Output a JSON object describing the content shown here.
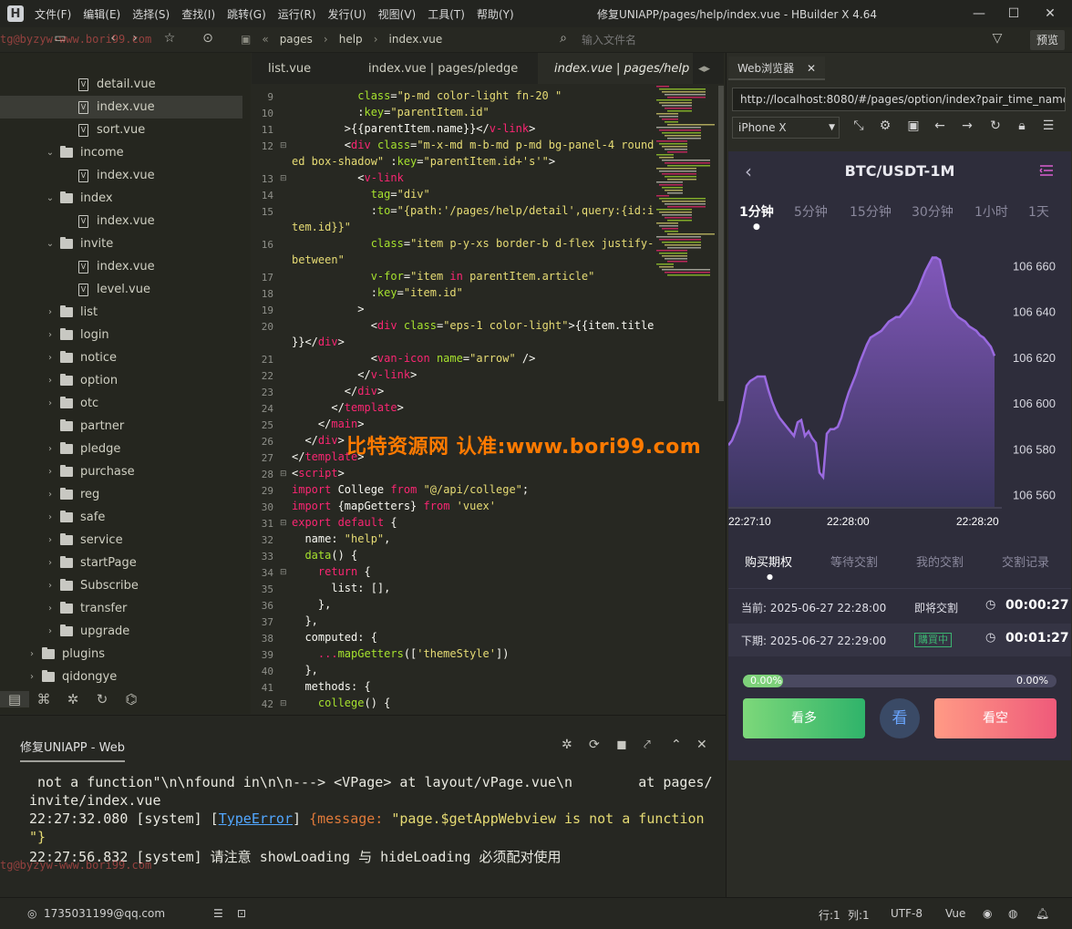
{
  "titlebar": {
    "logo": "H",
    "menus": [
      "文件(F)",
      "编辑(E)",
      "选择(S)",
      "查找(I)",
      "跳转(G)",
      "运行(R)",
      "发行(U)",
      "视图(V)",
      "工具(T)",
      "帮助(Y)"
    ],
    "title": "修复UNIAPP/pages/help/index.vue - HBuilder X 4.64"
  },
  "toolbar": {
    "crumbs": [
      "pages",
      "help",
      "index.vue"
    ],
    "file_search_placeholder": "输入文件名",
    "preview": "预览"
  },
  "sidebar": {
    "items": [
      {
        "label": "detail.vue",
        "type": "file",
        "depth": 2,
        "arrow": ""
      },
      {
        "label": "index.vue",
        "type": "file",
        "depth": 2,
        "arrow": "",
        "selected": true
      },
      {
        "label": "sort.vue",
        "type": "file",
        "depth": 2,
        "arrow": ""
      },
      {
        "label": "income",
        "type": "folder",
        "depth": 1,
        "arrow": "v"
      },
      {
        "label": "index.vue",
        "type": "file",
        "depth": 2,
        "arrow": ""
      },
      {
        "label": "index",
        "type": "folder",
        "depth": 1,
        "arrow": "v"
      },
      {
        "label": "index.vue",
        "type": "file",
        "depth": 2,
        "arrow": ""
      },
      {
        "label": "invite",
        "type": "folder",
        "depth": 1,
        "arrow": "v"
      },
      {
        "label": "index.vue",
        "type": "file",
        "depth": 2,
        "arrow": ""
      },
      {
        "label": "level.vue",
        "type": "file",
        "depth": 2,
        "arrow": ""
      },
      {
        "label": "list",
        "type": "folder",
        "depth": 1,
        "arrow": ">"
      },
      {
        "label": "login",
        "type": "folder",
        "depth": 1,
        "arrow": ">"
      },
      {
        "label": "notice",
        "type": "folder",
        "depth": 1,
        "arrow": ">"
      },
      {
        "label": "option",
        "type": "folder",
        "depth": 1,
        "arrow": ">"
      },
      {
        "label": "otc",
        "type": "folder",
        "depth": 1,
        "arrow": ">"
      },
      {
        "label": "partner",
        "type": "folder",
        "depth": 1,
        "arrow": ""
      },
      {
        "label": "pledge",
        "type": "folder",
        "depth": 1,
        "arrow": ">"
      },
      {
        "label": "purchase",
        "type": "folder",
        "depth": 1,
        "arrow": ">"
      },
      {
        "label": "reg",
        "type": "folder",
        "depth": 1,
        "arrow": ">"
      },
      {
        "label": "safe",
        "type": "folder",
        "depth": 1,
        "arrow": ">"
      },
      {
        "label": "service",
        "type": "folder",
        "depth": 1,
        "arrow": ">"
      },
      {
        "label": "startPage",
        "type": "folder",
        "depth": 1,
        "arrow": ">"
      },
      {
        "label": "Subscribe",
        "type": "folder",
        "depth": 1,
        "arrow": ">"
      },
      {
        "label": "transfer",
        "type": "folder",
        "depth": 1,
        "arrow": ">"
      },
      {
        "label": "upgrade",
        "type": "folder",
        "depth": 1,
        "arrow": ">"
      },
      {
        "label": "plugins",
        "type": "folder",
        "depth": 0,
        "arrow": ">"
      },
      {
        "label": "qidongye",
        "type": "folder",
        "depth": 0,
        "arrow": ">"
      }
    ]
  },
  "editor": {
    "tabs": [
      "list.vue",
      "index.vue | pages/pledge",
      "index.vue | pages/help"
    ],
    "lines": [
      {
        "n": "9",
        "fold": false,
        "parts": [
          [
            "          ",
            "p"
          ],
          [
            "class",
            "a"
          ],
          [
            "=",
            "p"
          ],
          [
            "\"p-md color-light fn-20 \"",
            "s"
          ]
        ]
      },
      {
        "n": "10",
        "fold": false,
        "parts": [
          [
            "          :",
            "p"
          ],
          [
            "key",
            "a"
          ],
          [
            "=",
            "p"
          ],
          [
            "\"parentItem.id\"",
            "s"
          ]
        ]
      },
      {
        "n": "11",
        "fold": false,
        "parts": [
          [
            "        >{{parentItem.name}}</",
            "p"
          ],
          [
            "v-link",
            "t"
          ],
          [
            ">",
            "p"
          ]
        ]
      },
      {
        "n": "12",
        "fold": true,
        "parts": [
          [
            "        <",
            "p"
          ],
          [
            "div",
            "t"
          ],
          [
            " ",
            "p"
          ],
          [
            "class",
            "a"
          ],
          [
            "=",
            "p"
          ],
          [
            "\"m-x-md m-b-md p-md bg-panel-4 round",
            "s"
          ]
        ]
      },
      {
        "n": "",
        "fold": false,
        "parts": [
          [
            "ed box-shadow\"",
            "s"
          ],
          [
            " :",
            "p"
          ],
          [
            "key",
            "a"
          ],
          [
            "=",
            "p"
          ],
          [
            "\"parentItem.id+'s'\"",
            "s"
          ],
          [
            ">",
            "p"
          ]
        ]
      },
      {
        "n": "13",
        "fold": true,
        "parts": [
          [
            "          <",
            "p"
          ],
          [
            "v-link",
            "t"
          ]
        ]
      },
      {
        "n": "14",
        "fold": false,
        "parts": [
          [
            "            ",
            "p"
          ],
          [
            "tag",
            "a"
          ],
          [
            "=",
            "p"
          ],
          [
            "\"div\"",
            "s"
          ]
        ]
      },
      {
        "n": "15",
        "fold": false,
        "parts": [
          [
            "            :",
            "p"
          ],
          [
            "to",
            "a"
          ],
          [
            "=",
            "p"
          ],
          [
            "\"{path:'/pages/help/detail',query:{id:i",
            "s"
          ]
        ]
      },
      {
        "n": "",
        "fold": false,
        "parts": [
          [
            "tem.id}}\"",
            "s"
          ]
        ]
      },
      {
        "n": "16",
        "fold": false,
        "parts": [
          [
            "            ",
            "p"
          ],
          [
            "class",
            "a"
          ],
          [
            "=",
            "p"
          ],
          [
            "\"item p-y-xs border-b d-flex justify-",
            "s"
          ]
        ]
      },
      {
        "n": "",
        "fold": false,
        "parts": [
          [
            "between\"",
            "s"
          ]
        ]
      },
      {
        "n": "17",
        "fold": false,
        "parts": [
          [
            "            ",
            "p"
          ],
          [
            "v-for",
            "a"
          ],
          [
            "=",
            "p"
          ],
          [
            "\"item ",
            "s"
          ],
          [
            "in",
            "t"
          ],
          [
            " parentItem.article\"",
            "s"
          ]
        ]
      },
      {
        "n": "18",
        "fold": false,
        "parts": [
          [
            "            :",
            "p"
          ],
          [
            "key",
            "a"
          ],
          [
            "=",
            "p"
          ],
          [
            "\"item.id\"",
            "s"
          ]
        ]
      },
      {
        "n": "19",
        "fold": false,
        "parts": [
          [
            "          >",
            "p"
          ]
        ]
      },
      {
        "n": "20",
        "fold": false,
        "parts": [
          [
            "            <",
            "p"
          ],
          [
            "div",
            "t"
          ],
          [
            " ",
            "p"
          ],
          [
            "class",
            "a"
          ],
          [
            "=",
            "p"
          ],
          [
            "\"eps-1 color-light\"",
            "s"
          ],
          [
            ">{{item.title",
            "p"
          ]
        ]
      },
      {
        "n": "",
        "fold": false,
        "parts": [
          [
            "}}</",
            "p"
          ],
          [
            "div",
            "t"
          ],
          [
            ">",
            "p"
          ]
        ]
      },
      {
        "n": "21",
        "fold": false,
        "parts": [
          [
            "            <",
            "p"
          ],
          [
            "van-icon",
            "t"
          ],
          [
            " ",
            "p"
          ],
          [
            "name",
            "a"
          ],
          [
            "=",
            "p"
          ],
          [
            "\"arrow\"",
            "s"
          ],
          [
            " />",
            "p"
          ]
        ]
      },
      {
        "n": "22",
        "fold": false,
        "parts": [
          [
            "          </",
            "p"
          ],
          [
            "v-link",
            "t"
          ],
          [
            ">",
            "p"
          ]
        ]
      },
      {
        "n": "23",
        "fold": false,
        "parts": [
          [
            "        </",
            "p"
          ],
          [
            "div",
            "t"
          ],
          [
            ">",
            "p"
          ]
        ]
      },
      {
        "n": "24",
        "fold": false,
        "parts": [
          [
            "      </",
            "p"
          ],
          [
            "template",
            "t"
          ],
          [
            ">",
            "p"
          ]
        ]
      },
      {
        "n": "25",
        "fold": false,
        "parts": [
          [
            "    </",
            "p"
          ],
          [
            "main",
            "t"
          ],
          [
            ">",
            "p"
          ]
        ]
      },
      {
        "n": "26",
        "fold": false,
        "parts": [
          [
            "  </",
            "p"
          ],
          [
            "div",
            "t"
          ],
          [
            ">",
            "p"
          ]
        ]
      },
      {
        "n": "27",
        "fold": false,
        "parts": [
          [
            "</",
            "p"
          ],
          [
            "template",
            "t"
          ],
          [
            ">",
            "p"
          ]
        ]
      },
      {
        "n": "28",
        "fold": true,
        "parts": [
          [
            "<",
            "p"
          ],
          [
            "script",
            "t"
          ],
          [
            ">",
            "p"
          ]
        ]
      },
      {
        "n": "29",
        "fold": false,
        "parts": [
          [
            "import",
            "k"
          ],
          [
            " College ",
            "p"
          ],
          [
            "from",
            "k"
          ],
          [
            " ",
            "p"
          ],
          [
            "\"@/api/college\"",
            "s"
          ],
          [
            ";",
            "p"
          ]
        ]
      },
      {
        "n": "30",
        "fold": false,
        "parts": [
          [
            "import",
            "k"
          ],
          [
            " {mapGetters} ",
            "p"
          ],
          [
            "from",
            "k"
          ],
          [
            " ",
            "p"
          ],
          [
            "'vuex'",
            "s"
          ]
        ]
      },
      {
        "n": "31",
        "fold": true,
        "parts": [
          [
            "export",
            "k"
          ],
          [
            " ",
            "p"
          ],
          [
            "default",
            "k"
          ],
          [
            " {",
            "p"
          ]
        ]
      },
      {
        "n": "32",
        "fold": false,
        "parts": [
          [
            "  name: ",
            "p"
          ],
          [
            "\"help\"",
            "s"
          ],
          [
            ",",
            "p"
          ]
        ]
      },
      {
        "n": "33",
        "fold": false,
        "parts": [
          [
            "  ",
            "p"
          ],
          [
            "data",
            "f"
          ],
          [
            "() {",
            "p"
          ]
        ]
      },
      {
        "n": "34",
        "fold": true,
        "parts": [
          [
            "    ",
            "p"
          ],
          [
            "return",
            "k"
          ],
          [
            " {",
            "p"
          ]
        ]
      },
      {
        "n": "35",
        "fold": false,
        "parts": [
          [
            "      list: [],",
            "p"
          ]
        ]
      },
      {
        "n": "36",
        "fold": false,
        "parts": [
          [
            "    },",
            "p"
          ]
        ]
      },
      {
        "n": "37",
        "fold": false,
        "parts": [
          [
            "  },",
            "p"
          ]
        ]
      },
      {
        "n": "38",
        "fold": false,
        "parts": [
          [
            "  computed: {",
            "p"
          ]
        ]
      },
      {
        "n": "39",
        "fold": false,
        "parts": [
          [
            "    ...",
            "k"
          ],
          [
            "mapGetters",
            "f"
          ],
          [
            "([",
            "p"
          ],
          [
            "'themeStyle'",
            "s"
          ],
          [
            "])",
            "p"
          ]
        ]
      },
      {
        "n": "40",
        "fold": false,
        "parts": [
          [
            "  },",
            "p"
          ]
        ]
      },
      {
        "n": "41",
        "fold": false,
        "parts": [
          [
            "  methods: {",
            "p"
          ]
        ]
      },
      {
        "n": "42",
        "fold": true,
        "parts": [
          [
            "    ",
            "p"
          ],
          [
            "college",
            "f"
          ],
          [
            "() {",
            "p"
          ]
        ]
      }
    ]
  },
  "watermark": {
    "main": "比特资源网 认准:www.bori99.com",
    "small": "tg@byzyw-www.bori99.com"
  },
  "browser": {
    "tab": "Web浏览器",
    "url": "http://localhost:8080/#/pages/option/index?pair_time_name=",
    "device": "iPhone X",
    "pair": "BTC/USDT-1M",
    "periods": [
      "1分钟",
      "5分钟",
      "15分钟",
      "30分钟",
      "1小时",
      "1天"
    ],
    "trade_tabs": [
      "购买期权",
      "等待交割",
      "我的交割",
      "交割记录"
    ],
    "current": {
      "label": "当前: 2025-06-27 22:28:00",
      "status": "即将交割",
      "countdown": "00:00:27"
    },
    "next": {
      "label": "下期: 2025-06-27 22:29:00",
      "status": "購買中",
      "countdown": "00:01:27"
    },
    "progress": {
      "value": 0.0,
      "left": "0.00%",
      "right": "0.00%"
    },
    "buttons": {
      "long": "看多",
      "look": "看",
      "short": "看空"
    },
    "colors": {
      "accent_up": "#2fb36a",
      "accent_down": "#ef5a7a",
      "line": "#9a6ae0"
    }
  },
  "chart_data": {
    "type": "area",
    "title": "",
    "x_ticks": [
      "22:27:10",
      "22:28:00",
      "22:28:20"
    ],
    "y_ticks": [
      106660,
      106640,
      106620,
      106600,
      106580,
      106560
    ],
    "ylim": [
      106555,
      106665
    ],
    "x": [
      0,
      4,
      8,
      12,
      16,
      20,
      24,
      28,
      32,
      36,
      40,
      44,
      48,
      52,
      56,
      60,
      64,
      68,
      72,
      76,
      80,
      84,
      88,
      92,
      96,
      100,
      104,
      108,
      112,
      116,
      120,
      124,
      128,
      132,
      136,
      140,
      144,
      148,
      152,
      156,
      160,
      164,
      168,
      172,
      176,
      180,
      184,
      188,
      192,
      196,
      200,
      204,
      208,
      212,
      216,
      220,
      224,
      228,
      232,
      236,
      240,
      244,
      248,
      252,
      256,
      260,
      264,
      268,
      272,
      276,
      280,
      284,
      288,
      292
    ],
    "values": [
      106582,
      106584,
      106588,
      106592,
      106600,
      106608,
      106610,
      106611,
      106612,
      106612,
      106612,
      106606,
      106601,
      106597,
      106594,
      106592,
      106590,
      106588,
      106586,
      106592,
      106593,
      106586,
      106588,
      106585,
      106583,
      106570,
      106568,
      106587,
      106589,
      106589,
      106590,
      106594,
      106600,
      106605,
      106609,
      106613,
      106618,
      106622,
      106626,
      106629,
      106630,
      106631,
      106632,
      106634,
      106636,
      106637,
      106638,
      106638,
      106640,
      106642,
      106644,
      106647,
      106650,
      106654,
      106658,
      106661,
      106664,
      106664,
      106663,
      106656,
      106648,
      106642,
      106640,
      106638,
      106637,
      106636,
      106634,
      106633,
      106632,
      106630,
      106629,
      106627,
      106625,
      106621
    ],
    "grid": false,
    "legend": ""
  },
  "console": {
    "tab": "修复UNIAPP - Web",
    "line1": " not a function\"\\n\\nfound in\\n\\n---> <VPage> at layout/vPage.vue\\n        at pages/",
    "line2": "invite/index.vue",
    "line3_time": "22:27:32.080 [system] [",
    "line3_type": "TypeError",
    "line3_mid": "] ",
    "line3_msg_key": "{message: ",
    "line3_msg_val": "\"page.$getAppWebview is not a function",
    "line4": "\"}",
    "line5": "22:27:56.832 [system] 请注意 showLoading 与 hideLoading 必须配对使用"
  },
  "statusbar": {
    "user": "1735031199@qq.com",
    "row": "行:1",
    "col": "列:1",
    "encoding": "UTF-8",
    "lang": "Vue"
  }
}
